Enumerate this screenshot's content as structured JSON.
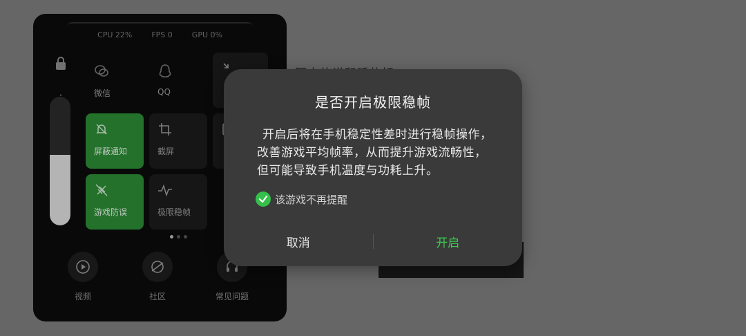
{
  "panel": {
    "stats": {
      "cpu": "CPU 22%",
      "fps": "FPS 0",
      "gpu": "GPU 0%"
    },
    "brightness_level": 0.55,
    "tiles": [
      {
        "label": "微信",
        "icon": "wechat-icon",
        "style": "plain"
      },
      {
        "label": "QQ",
        "icon": "qq-icon",
        "style": "plain"
      },
      {
        "label": "屏蔽通知",
        "icon": "bell-off-icon",
        "style": "green"
      },
      {
        "label": "截屏",
        "icon": "crop-icon",
        "style": "dark"
      },
      {
        "label": "游戏防误",
        "icon": "no-touch-icon",
        "style": "green"
      },
      {
        "label": "极限稳帧",
        "icon": "pulse-icon",
        "style": "dark"
      }
    ],
    "bottom": [
      {
        "label": "视频",
        "icon": "play-icon"
      },
      {
        "label": "社区",
        "icon": "planet-icon"
      },
      {
        "label": "常见问题",
        "icon": "headset-icon"
      }
    ]
  },
  "background": {
    "partial_text": "回去的说和睡的好"
  },
  "dialog": {
    "title": "是否开启极限稳帧",
    "body": "开启后将在手机稳定性差时进行稳帧操作，改善游戏平均帧率，从而提升游戏流畅性，但可能导致手机温度与功耗上升。",
    "checkbox_label": "该游戏不再提醒",
    "checkbox_checked": true,
    "cancel_label": "取消",
    "confirm_label": "开启"
  },
  "colors": {
    "accent_green": "#3ec952",
    "tile_green": "#2b8a35",
    "dialog_bg": "#3a3a3a"
  }
}
